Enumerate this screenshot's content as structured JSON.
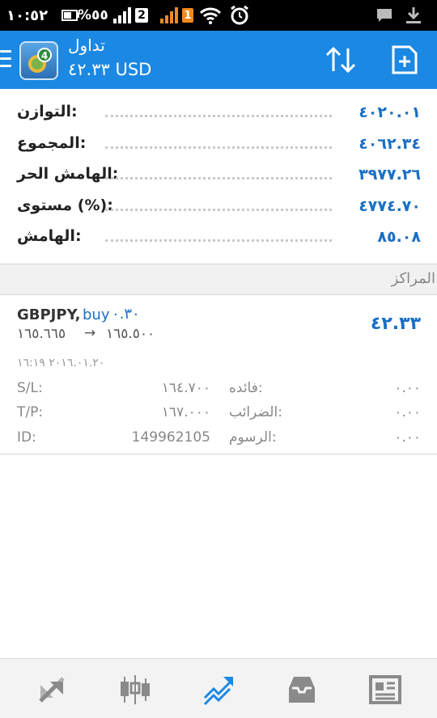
{
  "status_bar": {
    "time": "١٠:٥٢",
    "battery_percent": "%٥٥",
    "sim1_label": "2",
    "sim2_label": "1"
  },
  "header": {
    "title": "تداول",
    "subtitle": "٤٢.٣٣ USD"
  },
  "account": {
    "rows": [
      {
        "label": "التوازن:",
        "value": "٤٠٢٠.٠١"
      },
      {
        "label": "المجموع:",
        "value": "٤٠٦٢.٣٤"
      },
      {
        "label": "الهامش الحر:",
        "value": "٣٩٧٧.٢٦"
      },
      {
        "label": "مستوى (%):",
        "value": "٤٧٧٤.٧٠"
      },
      {
        "label": "الهامش:",
        "value": "٨٥.٠٨"
      }
    ]
  },
  "positions": {
    "section_title": "المراكز",
    "item": {
      "symbol": "GBPJPY,",
      "type": "buy",
      "lots": "٠.٣٠",
      "profit": "٤٢.٣٣",
      "open_price": "١٦٥.٦٦٥",
      "arrow": "→",
      "current_price": "١٦٥.٥٠٠",
      "time": "٢٠١٦.٠١.٢٠ ١٦:١٩",
      "sl_label": "S/L:",
      "sl_value": "١٦٤.٧٠٠",
      "tp_label": "T/P:",
      "tp_value": "١٦٧.٠٠٠",
      "id_label": "ID:",
      "id_value": "149962105",
      "interest_label": "فائده:",
      "interest_value": "٠.٠٠",
      "taxes_label": "الضرائب:",
      "taxes_value": "٠.٠٠",
      "fees_label": "الرسوم:",
      "fees_value": "٠.٠٠"
    }
  },
  "bottom_nav": {
    "items": [
      "quotes-icon",
      "chart-icon",
      "trade-icon",
      "history-icon",
      "news-icon"
    ],
    "active": "trade-icon",
    "active_color": "#1b88e3",
    "inactive_color": "#8a8a8a"
  },
  "colors": {
    "header": "#1b88e3",
    "accent": "#1a6fc4"
  }
}
